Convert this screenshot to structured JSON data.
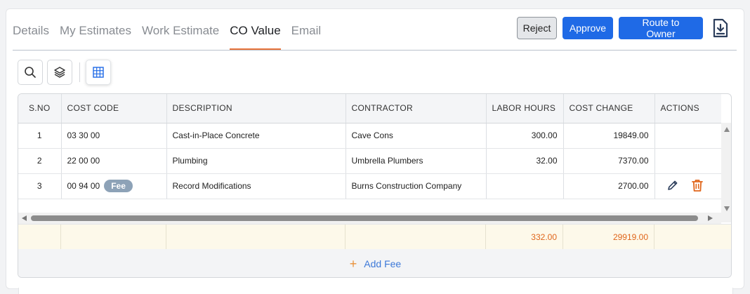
{
  "tabs": [
    {
      "label": "Details",
      "active": false
    },
    {
      "label": "My Estimates",
      "active": false
    },
    {
      "label": "Work Estimate",
      "active": false
    },
    {
      "label": "CO Value",
      "active": true
    },
    {
      "label": "Email",
      "active": false
    }
  ],
  "actions": {
    "reject": "Reject",
    "approve": "Approve",
    "route": "Route to Owner",
    "download_icon": "download-icon"
  },
  "toolbar": {
    "search_icon": "search-icon",
    "layers_icon": "layers-icon",
    "grid_icon": "grid-icon"
  },
  "table": {
    "columns": [
      "S.NO",
      "COST CODE",
      "DESCRIPTION",
      "CONTRACTOR",
      "LABOR HOURS",
      "COST CHANGE",
      "ACTIONS"
    ],
    "rows": [
      {
        "sno": "1",
        "cost_code": "03 30 00",
        "badge": "",
        "description": "Cast-in-Place Concrete",
        "contractor": "Cave Cons",
        "labor_hours": "300.00",
        "cost_change": "19849.00"
      },
      {
        "sno": "2",
        "cost_code": "22 00 00",
        "badge": "",
        "description": "Plumbing",
        "contractor": "Umbrella Plumbers",
        "labor_hours": "32.00",
        "cost_change": "7370.00"
      },
      {
        "sno": "3",
        "cost_code": "00 94 00",
        "badge": "Fee",
        "description": "Record Modifications",
        "contractor": "Burns Construction Company",
        "labor_hours": "",
        "cost_change": "2700.00"
      }
    ],
    "totals": {
      "labor_hours": "332.00",
      "cost_change": "29919.00"
    },
    "add_fee": "Add Fee"
  },
  "colors": {
    "primary": "#1f6ae6",
    "tab_accent": "#e8743b",
    "total_text": "#e0661b",
    "delete_icon": "#e0661b",
    "fee_badge": "#8da2b7"
  }
}
